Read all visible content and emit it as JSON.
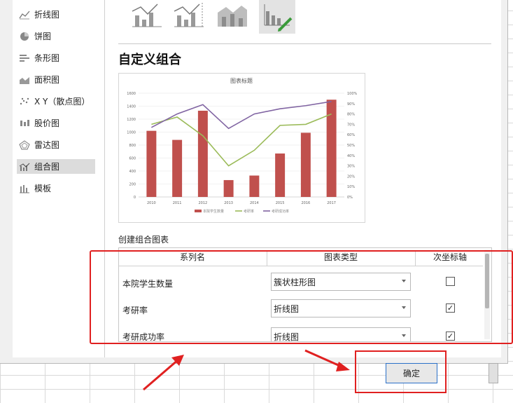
{
  "sidebar": {
    "items": [
      {
        "label": "折线图",
        "icon": "line-chart-icon"
      },
      {
        "label": "饼图",
        "icon": "pie-chart-icon"
      },
      {
        "label": "条形图",
        "icon": "bar-chart-icon"
      },
      {
        "label": "面积图",
        "icon": "area-chart-icon"
      },
      {
        "label": "X Y（散点图）",
        "icon": "scatter-chart-icon"
      },
      {
        "label": "股价图",
        "icon": "stock-chart-icon"
      },
      {
        "label": "雷达图",
        "icon": "radar-chart-icon"
      },
      {
        "label": "组合图",
        "icon": "combo-chart-icon",
        "active": true
      },
      {
        "label": "模板",
        "icon": "template-icon"
      }
    ]
  },
  "combo": {
    "title": "自定义组合",
    "create_label": "创建组合图表"
  },
  "table": {
    "headers": [
      "系列名",
      "图表类型",
      "次坐标轴"
    ],
    "rows": [
      {
        "name": "本院学生数量",
        "type": "簇状柱形图",
        "secondary": false
      },
      {
        "name": "考研率",
        "type": "折线图",
        "secondary": true
      },
      {
        "name": "考研成功率",
        "type": "折线图",
        "secondary": true
      }
    ]
  },
  "buttons": {
    "ok_label": "确定"
  },
  "colors": {
    "accent_red": "#e02020",
    "bar": "#c0504d",
    "line_green": "#9bbb59",
    "line_purple": "#8064a2"
  },
  "chart_data": {
    "type": "bar",
    "title": "图表标题",
    "categories": [
      "2010",
      "2011",
      "2012",
      "2013",
      "2014",
      "2015",
      "2016",
      "2017"
    ],
    "ylim": [
      0,
      1600
    ],
    "y_ticks": [
      "0",
      "200",
      "400",
      "600",
      "800",
      "1000",
      "1200",
      "1400",
      "1600"
    ],
    "y2lim": [
      0,
      100
    ],
    "y2_ticks": [
      "0%",
      "10%",
      "20%",
      "30%",
      "40%",
      "50%",
      "60%",
      "70%",
      "80%",
      "90%",
      "100%"
    ],
    "series": [
      {
        "name": "本院学生数量",
        "type": "bar",
        "axis": "primary",
        "values": [
          1020,
          880,
          1330,
          260,
          330,
          670,
          990,
          1500
        ]
      },
      {
        "name": "考研率",
        "type": "line",
        "axis": "secondary",
        "values": [
          70,
          77,
          59,
          30,
          45,
          69,
          70,
          80
        ]
      },
      {
        "name": "考研成功率",
        "type": "line",
        "axis": "secondary",
        "values": [
          67,
          80,
          89,
          66,
          80,
          85,
          88,
          92
        ]
      }
    ],
    "legend": "bottom"
  }
}
